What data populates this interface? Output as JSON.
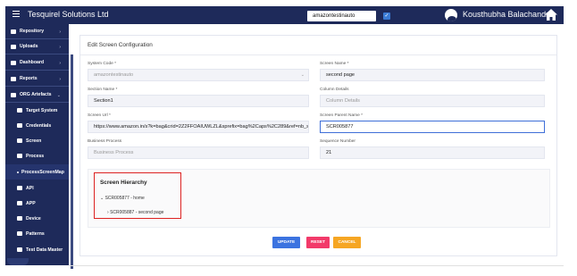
{
  "app": {
    "title": "Tesquirel Solutions Ltd"
  },
  "topbar": {
    "project_select": "amazontestinauto",
    "checkbox_checked": true,
    "user_name": "Kousthubha Balachandra"
  },
  "sidebar": {
    "items": [
      {
        "label": "Repository",
        "expandable": true
      },
      {
        "label": "Uploads",
        "expandable": true
      },
      {
        "label": "Dashboard",
        "expandable": true
      },
      {
        "label": "Reports",
        "expandable": true
      },
      {
        "label": "ORG Artefacts",
        "expandable": true,
        "expanded": true
      },
      {
        "label": "Target System"
      },
      {
        "label": "Credentials"
      },
      {
        "label": "Screen"
      },
      {
        "label": "Process"
      },
      {
        "label": "ProcessScreenMap",
        "active": true
      },
      {
        "label": "API"
      },
      {
        "label": "APP"
      },
      {
        "label": "Device"
      },
      {
        "label": "Patterns"
      },
      {
        "label": "Test Data Master"
      }
    ]
  },
  "form": {
    "header": "Edit Screen Configuration",
    "system_code": {
      "label": "System Code *",
      "value": "amazontestinauto"
    },
    "screen_name": {
      "label": "Screen Name *",
      "value": "second page"
    },
    "section_name": {
      "label": "Section Name *",
      "value": "Section1"
    },
    "column_details": {
      "label": "Column Details",
      "placeholder": "Column Details"
    },
    "screen_url": {
      "label": "Screen Url *",
      "value": "https://www.amazon.in/s?k=bag&crid=2Z2FFOAIUWLZL&sprefix=bag%2Caps%2C289&ref=nb_sb_"
    },
    "screen_parent_name": {
      "label": "Screen Parent Name *",
      "value": "SCR005877"
    },
    "business_process": {
      "label": "Business Process",
      "placeholder": "Business Process"
    },
    "sequence_number": {
      "label": "Sequence Number",
      "value": "21"
    }
  },
  "hierarchy": {
    "title": "Screen Hierarchy",
    "root": "SCR005877 - home",
    "child": "SCR005887 - second page"
  },
  "buttons": {
    "update": "UPDATE",
    "reset": "RESET",
    "cancel": "CANCEL"
  },
  "colors": {
    "nav": "#1e2a5a",
    "update": "#3b73e0",
    "reset": "#f23a6a",
    "cancel": "#f6a623",
    "highlight": "#dd2222"
  }
}
